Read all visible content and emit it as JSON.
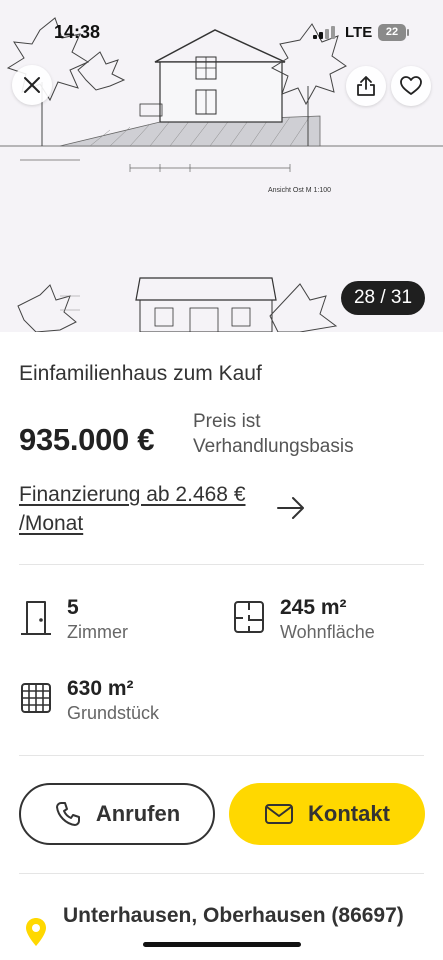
{
  "status_bar": {
    "time": "14:38",
    "network": "LTE",
    "battery": "22"
  },
  "gallery": {
    "image_caption": "Ansicht Ost M 1:100",
    "counter": "28 / 31"
  },
  "listing": {
    "type": "Einfamilienhaus zum Kauf",
    "price": "935.000 €",
    "price_note": "Preis ist Verhandlungsbasis",
    "financing_link": "Finanzierung ab 2.468 € /Monat"
  },
  "features": [
    {
      "icon": "door-icon",
      "value": "5",
      "label": "Zimmer"
    },
    {
      "icon": "floorplan-icon",
      "value": "245 m²",
      "label": "Wohnfläche"
    },
    {
      "icon": "grid-icon",
      "value": "630 m²",
      "label": "Grundstück"
    }
  ],
  "actions": {
    "call_label": "Anrufen",
    "contact_label": "Kontakt"
  },
  "location": {
    "text": "Unterhausen, Oberhausen (86697)"
  },
  "colors": {
    "accent": "#ffd800",
    "text": "#333333",
    "counter_bg": "#1f1f1f"
  }
}
